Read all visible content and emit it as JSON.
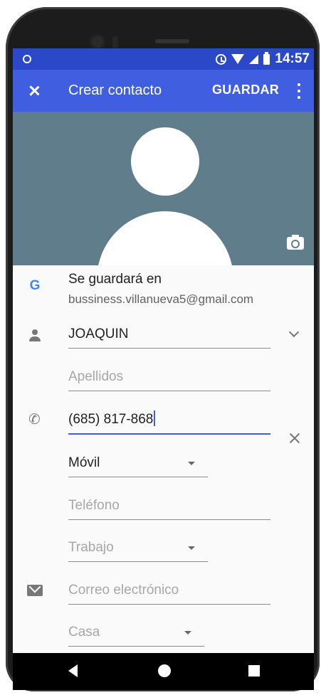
{
  "status_bar": {
    "time": "14:57"
  },
  "toolbar": {
    "title": "Crear contacto",
    "save_label": "GUARDAR"
  },
  "account": {
    "label": "Se guardará en",
    "email": "bussiness.villanueva5@gmail.com"
  },
  "form": {
    "first_name": {
      "value": "JOAQUIN"
    },
    "last_name": {
      "placeholder": "Apellidos"
    },
    "phone": {
      "value": "(685) 817-868",
      "type": "Móvil"
    },
    "phone2": {
      "placeholder": "Teléfono",
      "type": "Trabajo"
    },
    "email": {
      "placeholder": "Correo electrónico",
      "type": "Casa"
    }
  },
  "colors": {
    "status_bar": "#2a48c8",
    "toolbar": "#3f5fe0",
    "photo_bg": "#607d8b"
  },
  "icons": [
    "close-icon",
    "more-vert-icon",
    "camera-icon",
    "google-icon",
    "person-icon",
    "phone-icon",
    "email-icon",
    "chevron-down-icon",
    "clear-icon"
  ]
}
